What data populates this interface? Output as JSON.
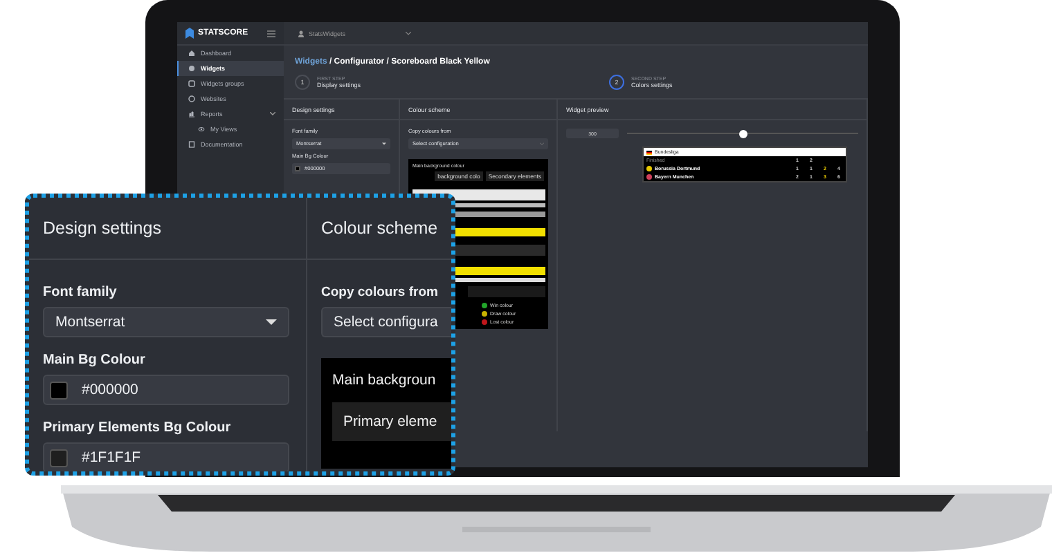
{
  "brand": "STATSCORE",
  "topbar": {
    "account": "StatsWidgets"
  },
  "sidebar": {
    "items": [
      {
        "label": "Dashboard",
        "selected": false
      },
      {
        "label": "Widgets",
        "selected": true
      },
      {
        "label": "Widgets groups",
        "selected": false
      },
      {
        "label": "Websites",
        "selected": false
      },
      {
        "label": "Reports",
        "selected": false,
        "expanded": true,
        "children": [
          {
            "label": "My Views",
            "selected": false
          }
        ]
      },
      {
        "label": "Documentation",
        "selected": false
      }
    ]
  },
  "breadcrumb": {
    "link": "Widgets",
    "rest": " / Configurator / Scoreboard Black Yellow"
  },
  "steps": [
    {
      "number": "1",
      "label": "FIRST STEP",
      "title": "Display settings",
      "selected": false
    },
    {
      "number": "2",
      "label": "SECOND STEP",
      "title": "Colors settings",
      "selected": true
    }
  ],
  "design_panel": {
    "title": "Design settings",
    "font_label": "Font family",
    "font_value": "Montserrat",
    "bg_label": "Main Bg Colour",
    "bg_value": "#000000"
  },
  "colour_panel": {
    "title": "Colour scheme",
    "copy_label": "Copy colours from",
    "copy_placeholder": "Select configuration",
    "preview_title": "Main background colour",
    "chips": [
      "background colo",
      "Secondary elements"
    ],
    "legend": [
      {
        "label": "Win colour",
        "color": "#22a52a"
      },
      {
        "label": "Draw colour",
        "color": "#c9b300"
      },
      {
        "label": "Lost colour",
        "color": "#c0161b"
      }
    ]
  },
  "preview_panel": {
    "title": "Widget preview",
    "size": "300",
    "level": 0.5,
    "scoreboard": {
      "league": "Bundesliga",
      "status": "Finished",
      "columns": [
        "1",
        "2"
      ],
      "teams": [
        {
          "name": "Borussia Dortmund",
          "color": "#e8c800",
          "scores": [
            "1",
            "1",
            "2",
            "4"
          ]
        },
        {
          "name": "Bayern Munchen",
          "color": "#d0405a",
          "scores": [
            "2",
            "1",
            "3",
            "6"
          ]
        }
      ]
    }
  },
  "callout": {
    "left_title": "Design settings",
    "right_title": "Colour scheme",
    "font_label": "Font family",
    "font_value": "Montserrat",
    "bg_label": "Main Bg Colour",
    "bg_value": "#000000",
    "primary_label": "Primary Elements Bg Colour",
    "primary_value": "#1F1F1F",
    "copy_label": "Copy colours from",
    "copy_value": "Select configura",
    "main_bg": "Main backgroun",
    "primary_elem": "Primary eleme"
  }
}
